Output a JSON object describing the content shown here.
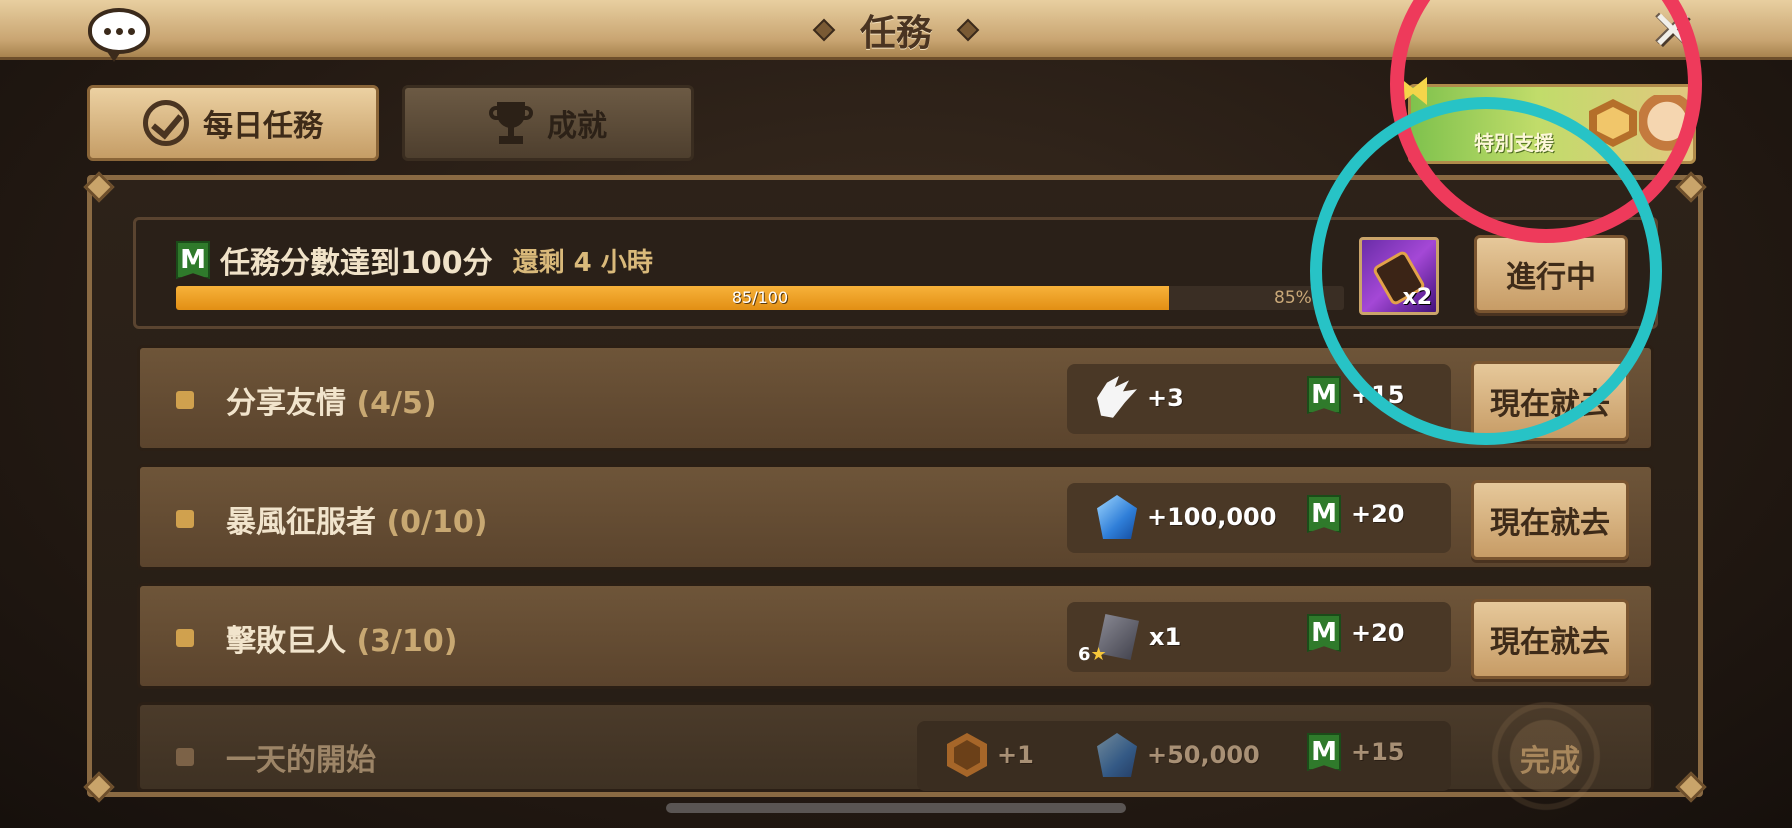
{
  "header": {
    "title": "任務",
    "close_label": "✕"
  },
  "tabs": [
    {
      "label": "每日任務",
      "active": true,
      "icon": "check-circle-icon"
    },
    {
      "label": "成就",
      "active": false,
      "icon": "trophy-icon"
    }
  ],
  "banner": {
    "text": "特別支援"
  },
  "score": {
    "badge": "M",
    "title": "任務分數達到100分",
    "remaining": "還剩 4 小時",
    "progress_text": "85/100",
    "progress_percent": "85%",
    "progress_fraction": 0.85,
    "reward_qty": "x2",
    "status_button": "進行中"
  },
  "missions": [
    {
      "label": "分享友情",
      "count": "(4/5)",
      "reward1": {
        "icon": "wing-icon",
        "value": "+3"
      },
      "reward2": {
        "badge": "M",
        "value": "+15"
      },
      "button": "現在就去"
    },
    {
      "label": "暴風征服者",
      "count": "(0/10)",
      "reward1": {
        "icon": "crystal-icon",
        "value": "+100,000"
      },
      "reward2": {
        "badge": "M",
        "value": "+20"
      },
      "button": "現在就去"
    },
    {
      "label": "擊敗巨人",
      "count": "(3/10)",
      "reward1": {
        "icon": "rune-scroll-icon",
        "value": "x1",
        "star_label": "6"
      },
      "reward2": {
        "badge": "M",
        "value": "+20"
      },
      "button": "現在就去"
    },
    {
      "label": "一天的開始",
      "count": "",
      "reward0": {
        "icon": "sprout-hex-icon",
        "value": "+1"
      },
      "reward1": {
        "icon": "crystal-icon",
        "value": "+50,000"
      },
      "reward2": {
        "badge": "M",
        "value": "+15"
      },
      "button": "完成"
    }
  ],
  "colors": {
    "progress": "#e8961a",
    "m_badge": "#2f7a2b",
    "annotation_red": "#ee3a5b",
    "annotation_cyan": "#27c3c6"
  }
}
